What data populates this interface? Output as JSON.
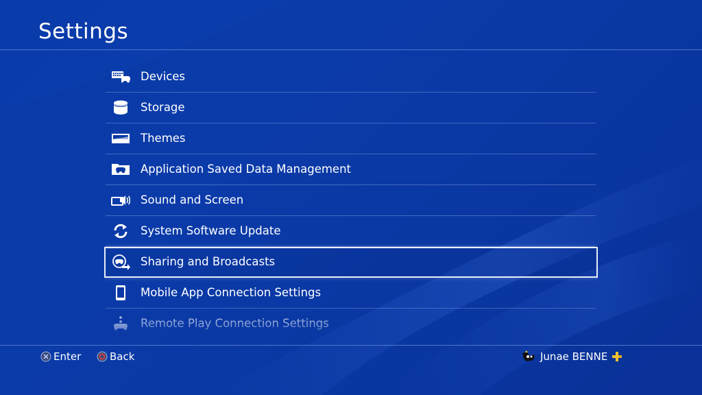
{
  "page": {
    "title": "Settings"
  },
  "menu": {
    "items": [
      {
        "label": "Devices",
        "icon": "devices-icon"
      },
      {
        "label": "Storage",
        "icon": "storage-icon"
      },
      {
        "label": "Themes",
        "icon": "themes-icon"
      },
      {
        "label": "Application Saved Data Management",
        "icon": "saved-data-icon"
      },
      {
        "label": "Sound and Screen",
        "icon": "sound-screen-icon"
      },
      {
        "label": "System Software Update",
        "icon": "system-update-icon"
      },
      {
        "label": "Sharing and Broadcasts",
        "icon": "sharing-broadcast-icon",
        "selected": true
      },
      {
        "label": "Mobile App Connection Settings",
        "icon": "mobile-app-icon"
      },
      {
        "label": "Remote Play Connection Settings",
        "icon": "remote-play-icon"
      }
    ]
  },
  "footer": {
    "enter_label": "Enter",
    "enter_icon": "cross-button-icon",
    "back_label": "Back",
    "back_icon": "circle-button-icon",
    "user_name": "Junae BENNE",
    "user_avatar": "avatar",
    "membership_icon": "ps-plus-icon"
  },
  "colors": {
    "background": "#0a38a4",
    "text": "#ffffff",
    "selection_border": "#e9eef8",
    "circle_button": "#e0403a",
    "plus_gold": "#f2c230"
  }
}
